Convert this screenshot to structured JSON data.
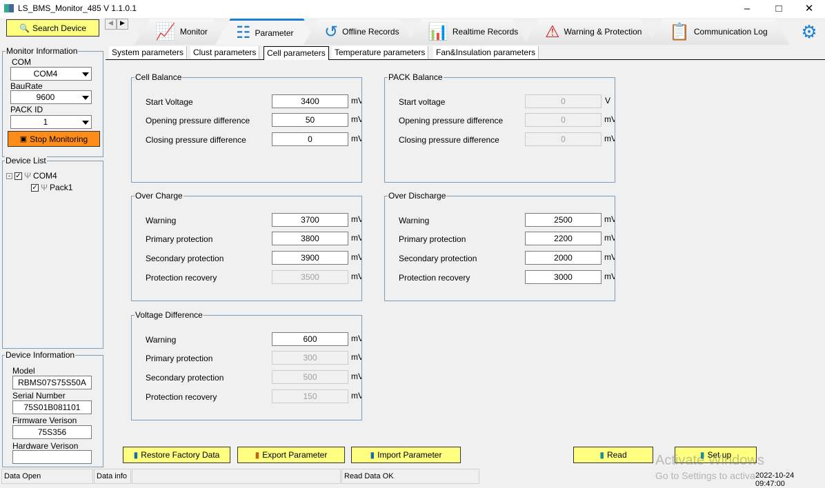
{
  "window": {
    "title": "LS_BMS_Monitor_485 V 1.1.0.1"
  },
  "search_button": "Search Device",
  "main_tabs": [
    {
      "label": "Monitor",
      "icon": "monitor-chart-icon"
    },
    {
      "label": "Parameter",
      "icon": "sliders-icon",
      "active": true
    },
    {
      "label": "Offline Records",
      "icon": "history-clock-icon"
    },
    {
      "label": "Realtime Records",
      "icon": "bar-chart-icon"
    },
    {
      "label": "Warning & Protection",
      "icon": "warning-triangle-icon"
    },
    {
      "label": "Communication Log",
      "icon": "clipboard-icon"
    }
  ],
  "sub_tabs": [
    {
      "label": "System parameters"
    },
    {
      "label": "Clust parameters"
    },
    {
      "label": "Cell parameters",
      "active": true
    },
    {
      "label": "Temperature parameters"
    },
    {
      "label": "Fan&Insulation parameters"
    }
  ],
  "monitor_info": {
    "title": "Monitor Information",
    "com_label": "COM",
    "com_value": "COM4",
    "baud_label": "BauRate",
    "baud_value": "9600",
    "pack_label": "PACK ID",
    "pack_value": "1",
    "stop_button": "Stop Monitoring"
  },
  "device_list": {
    "title": "Device List",
    "root": "COM4",
    "child": "Pack1"
  },
  "device_info": {
    "title": "Device Information",
    "model_label": "Model",
    "model": "RBMS07S75S50A",
    "serial_label": "Serial Number",
    "serial": "75S01B081101",
    "fw_label": "Firmware Verison",
    "fw": "75S356",
    "hw_label": "Hardware Verison",
    "hw": ""
  },
  "groups": [
    {
      "title": "Cell Balance",
      "rows": [
        {
          "label": "Start Voltage",
          "value": "3400",
          "unit": "mV"
        },
        {
          "label": "Opening pressure difference",
          "value": "50",
          "unit": "mV"
        },
        {
          "label": "Closing pressure difference",
          "value": "0",
          "unit": "mV"
        }
      ]
    },
    {
      "title": "PACK Balance",
      "rows": [
        {
          "label": "Start voltage",
          "value": "0",
          "unit": "V",
          "disabled": true
        },
        {
          "label": "Opening pressure difference",
          "value": "0",
          "unit": "mV",
          "disabled": true
        },
        {
          "label": "Closing pressure difference",
          "value": "0",
          "unit": "mV",
          "disabled": true
        }
      ]
    },
    {
      "title": "Over Charge",
      "rows": [
        {
          "label": "Warning",
          "value": "3700",
          "unit": "mV"
        },
        {
          "label": "Primary protection",
          "value": "3800",
          "unit": "mV"
        },
        {
          "label": "Secondary protection",
          "value": "3900",
          "unit": "mV"
        },
        {
          "label": "Protection recovery",
          "value": "3500",
          "unit": "mV",
          "disabled": true
        }
      ]
    },
    {
      "title": "Over Discharge",
      "rows": [
        {
          "label": "Warning",
          "value": "2500",
          "unit": "mV"
        },
        {
          "label": "Primary protection",
          "value": "2200",
          "unit": "mV"
        },
        {
          "label": "Secondary protection",
          "value": "2000",
          "unit": "mV"
        },
        {
          "label": "Protection recovery",
          "value": "3000",
          "unit": "mV"
        }
      ]
    },
    {
      "title": "Voltage Difference",
      "rows": [
        {
          "label": "Warning",
          "value": "600",
          "unit": "mV"
        },
        {
          "label": "Primary protection",
          "value": "300",
          "unit": "mV",
          "disabled": true
        },
        {
          "label": "Secondary protection",
          "value": "500",
          "unit": "mV",
          "disabled": true
        },
        {
          "label": "Protection recovery",
          "value": "150",
          "unit": "mV",
          "disabled": true
        }
      ]
    }
  ],
  "buttons": {
    "restore": "Restore Factory Data",
    "export": "Export Parameter",
    "import": "Import Parameter",
    "read": "Read",
    "setup": "Set up"
  },
  "status": {
    "data_open": "Data Open",
    "data_info": "Data info",
    "read_status": "Read Data OK",
    "datetime": "2022-10-24 09:47:00"
  },
  "watermark": {
    "line1": "Activate Windows",
    "line2": "Go to Settings to activate Windows."
  }
}
